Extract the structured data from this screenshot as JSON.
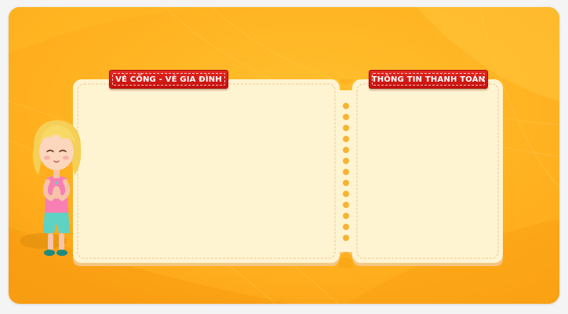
{
  "panels": {
    "family_ticket_title": "VÉ CỔNG - VÉ GIA ĐÌNH",
    "payment_info_title": "THÔNG TIN THANH TOÁN"
  },
  "colors": {
    "background": "#ffb21f",
    "panel_fill": "#fff4d2",
    "label_red": "#d9181a",
    "perforation": "#f7b331"
  },
  "illustration": {
    "icon": "girl-character-illustration"
  }
}
